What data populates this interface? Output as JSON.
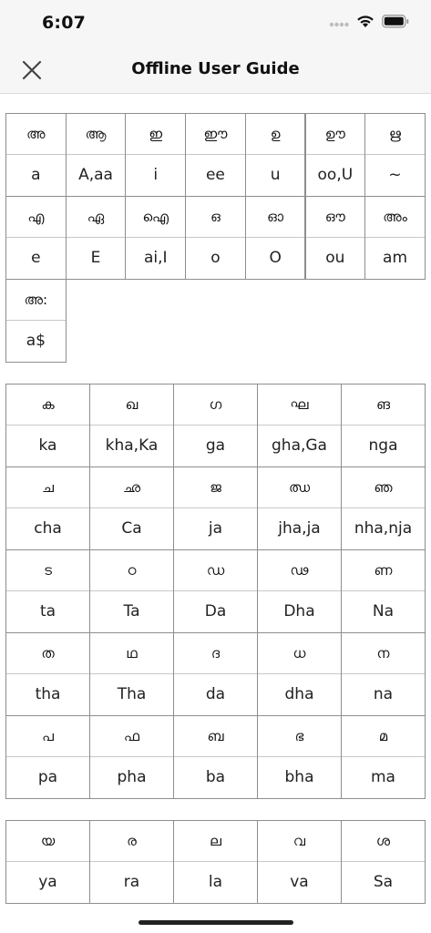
{
  "status_bar": {
    "time": "6:07",
    "icons": [
      "signal-dots-icon",
      "wifi-icon",
      "battery-icon"
    ]
  },
  "nav": {
    "title": "Offline User Guide",
    "close_icon": "close-icon"
  },
  "sections": [
    {
      "name": "vowels",
      "columns": 7,
      "cells": [
        {
          "glyph": "അ",
          "roman": "a"
        },
        {
          "glyph": "ആ",
          "roman": "A,aa"
        },
        {
          "glyph": "ഇ",
          "roman": "i"
        },
        {
          "glyph": "ഈ",
          "roman": "ee"
        },
        {
          "glyph": "ഉ",
          "roman": "u"
        },
        {
          "glyph": "ഊ",
          "roman": "oo,U"
        },
        {
          "glyph": "ഋ",
          "roman": "~"
        },
        {
          "glyph": "എ",
          "roman": "e"
        },
        {
          "glyph": "ഏ",
          "roman": "E"
        },
        {
          "glyph": "ഐ",
          "roman": "ai,I"
        },
        {
          "glyph": "ഒ",
          "roman": "o"
        },
        {
          "glyph": "ഓ",
          "roman": "O"
        },
        {
          "glyph": "ഔ",
          "roman": "ou"
        },
        {
          "glyph": "അം",
          "roman": "am"
        },
        {
          "glyph": "അ:",
          "roman": "a$"
        }
      ]
    },
    {
      "name": "consonants",
      "columns": 5,
      "cells": [
        {
          "glyph": "ക",
          "roman": "ka"
        },
        {
          "glyph": "ഖ",
          "roman": "kha,Ka"
        },
        {
          "glyph": "ഗ",
          "roman": "ga"
        },
        {
          "glyph": "ഘ",
          "roman": "gha,Ga"
        },
        {
          "glyph": "ങ",
          "roman": "nga"
        },
        {
          "glyph": "ച",
          "roman": "cha"
        },
        {
          "glyph": "ഛ",
          "roman": "Ca"
        },
        {
          "glyph": "ജ",
          "roman": "ja"
        },
        {
          "glyph": "ഝ",
          "roman": "jha,ja"
        },
        {
          "glyph": "ഞ",
          "roman": "nha,nja"
        },
        {
          "glyph": "ട",
          "roman": "ta"
        },
        {
          "glyph": "ഠ",
          "roman": "Ta"
        },
        {
          "glyph": "ഡ",
          "roman": "Da"
        },
        {
          "glyph": "ഢ",
          "roman": "Dha"
        },
        {
          "glyph": "ണ",
          "roman": "Na"
        },
        {
          "glyph": "ത",
          "roman": "tha"
        },
        {
          "glyph": "ഥ",
          "roman": "Tha"
        },
        {
          "glyph": "ദ",
          "roman": "da"
        },
        {
          "glyph": "ധ",
          "roman": "dha"
        },
        {
          "glyph": "ന",
          "roman": "na"
        },
        {
          "glyph": "പ",
          "roman": "pa"
        },
        {
          "glyph": "ഫ",
          "roman": "pha"
        },
        {
          "glyph": "ബ",
          "roman": "ba"
        },
        {
          "glyph": "ഭ",
          "roman": "bha"
        },
        {
          "glyph": "മ",
          "roman": "ma"
        }
      ]
    },
    {
      "name": "semivowels",
      "columns": 5,
      "cells": [
        {
          "glyph": "യ",
          "roman": "ya"
        },
        {
          "glyph": "ര",
          "roman": "ra"
        },
        {
          "glyph": "ല",
          "roman": "la"
        },
        {
          "glyph": "വ",
          "roman": "va"
        },
        {
          "glyph": "ശ",
          "roman": "Sa"
        }
      ]
    }
  ]
}
